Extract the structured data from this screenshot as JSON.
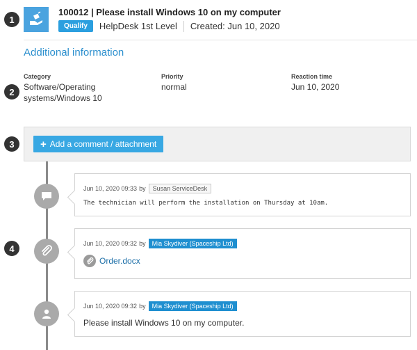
{
  "ticket": {
    "title": "100012 | Please install Windows 10 on my computer",
    "qualify_label": "Qualify",
    "queue": "HelpDesk 1st Level",
    "created": "Created: Jun 10, 2020",
    "icon": "ticket-hand-icon"
  },
  "steps": [
    "1",
    "2",
    "3",
    "4"
  ],
  "additional_info": {
    "title": "Additional information",
    "fields": [
      {
        "label": "Category",
        "value": "Software/Operating systems/Windows 10"
      },
      {
        "label": "Priority",
        "value": "normal"
      },
      {
        "label": "Reaction time",
        "value": "Jun 10, 2020"
      }
    ]
  },
  "comment_bar": {
    "add_label": "Add a comment / attachment"
  },
  "timeline": [
    {
      "timestamp": "Jun 10, 2020 09:33",
      "by": "by",
      "author": "Susan ServiceDesk",
      "author_style": "gray",
      "icon": "chat-bubble-icon",
      "text": "The technician will perform the installation on Thursday at 10am."
    },
    {
      "timestamp": "Jun 10, 2020 09:32",
      "by": "by",
      "author": "Mia Skydiver (Spaceship Ltd)",
      "author_style": "blue",
      "icon": "paperclip-icon",
      "attachment": "Order.docx"
    },
    {
      "timestamp": "Jun 10, 2020 09:32",
      "by": "by",
      "author": "Mia Skydiver (Spaceship Ltd)",
      "author_style": "blue",
      "icon": "user-icon",
      "text": "Please install Windows 10 on my computer."
    }
  ],
  "colors": {
    "accent": "#2b9fdf",
    "link": "#1d6fa8",
    "timeline": "#aaaaaa"
  }
}
